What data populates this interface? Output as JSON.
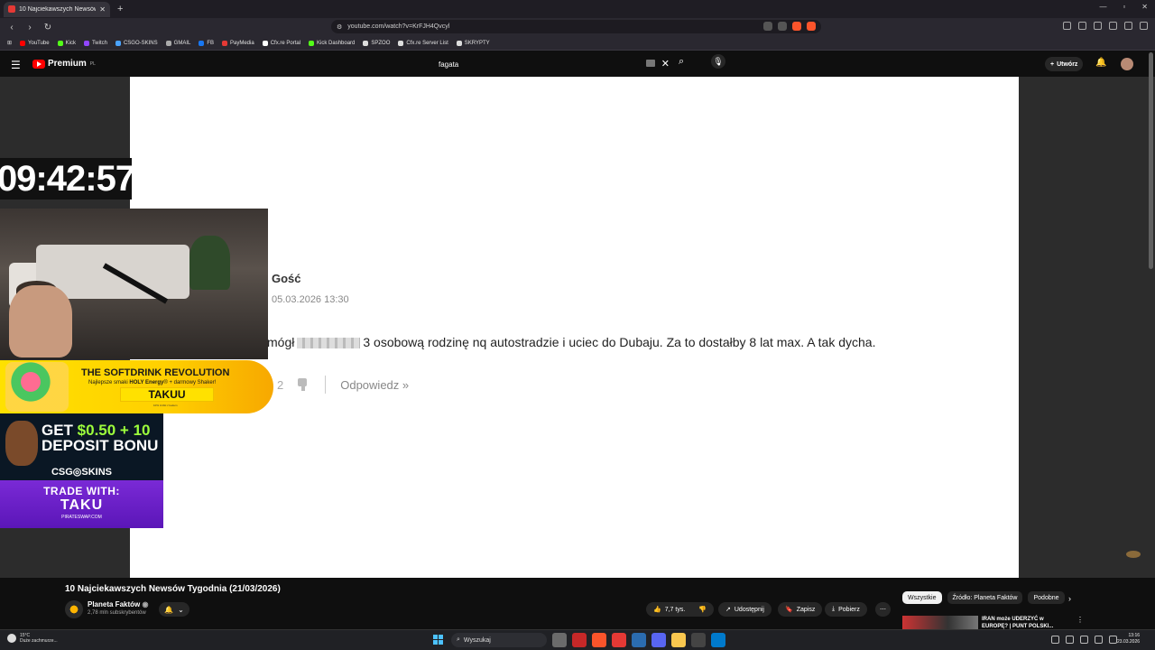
{
  "browser": {
    "tab_title": "10 Najciekawszych Newsów T...",
    "tab_close": "✕",
    "new_tab": "+",
    "url": "youtube.com/watch?v=KrFJH4Qvcyl",
    "bookmarks": [
      {
        "label": "YouTube",
        "color": "#ff0000"
      },
      {
        "label": "Kick",
        "color": "#53fc18"
      },
      {
        "label": "Twitch",
        "color": "#9146ff"
      },
      {
        "label": "CSGO-SKINS",
        "color": "#4aa3ff"
      },
      {
        "label": "GMAIL",
        "color": "#aaaaaa"
      },
      {
        "label": "FB",
        "color": "#1877f2"
      },
      {
        "label": "PayMedia",
        "color": "#e53935"
      },
      {
        "label": "Cfx.re Portal",
        "color": "#ffffff"
      },
      {
        "label": "Kick Dashboard",
        "color": "#53fc18"
      },
      {
        "label": "SPZOO",
        "color": "#dddddd"
      },
      {
        "label": "Cfx.re Server List",
        "color": "#dddddd"
      },
      {
        "label": "SKRYPTY",
        "color": "#dddddd"
      }
    ]
  },
  "youtube": {
    "brand": "Premium",
    "brand_region": "PL",
    "search_value": "fagata",
    "create_label": "Utwórz",
    "video_title": "10 Najciekawszych Newsów Tygodnia (21/03/2026)",
    "channel_name": "Planeta Faktów",
    "channel_subs": "2,78 mln subskrybentów",
    "like_count": "7,7 tys.",
    "share_label": "Udostępnij",
    "save_label": "Zapisz",
    "download_label": "Pobierz",
    "chips": [
      "Wszystkie",
      "Źródło: Planeta Faktów",
      "Podobne"
    ],
    "rec_title_1": "IRAN może UDERZYĆ w",
    "rec_title_2": "EUROPĘ? | PUNT POLSKI..."
  },
  "comment": {
    "author": "Gość",
    "date": "05.03.2026 13:30",
    "text_start": "mógł",
    "text_rest": "3 osobową rodzinę nq autostradzie i uciec do Dubaju. Za to dostałby 8 lat max. A tak dycha.",
    "vote_count": "2",
    "reply": "Odpowiedz »"
  },
  "overlay": {
    "clock": "09:42:57",
    "promo1_line1": "THE SOFTDRINK REVOLUTION",
    "promo1_line2a": "Najlepsze smaki ",
    "promo1_line2b": "HOLY Energy",
    "promo1_line2c": "® + darmowy Shaker!",
    "promo1_code": "TAKUU",
    "promo1_line3": "10% zniżki z kodem",
    "promo2_line1a": "GET ",
    "promo2_line1b": "$0.50 + 10",
    "promo2_line2": "DEPOSIT BONU",
    "promo2_brand": "CSG◎SKINS",
    "promo3_line1": "TRADE WITH:",
    "promo3_line2": "TAKU",
    "promo3_line3": "PIRATESWAP.COM"
  },
  "taskbar": {
    "weather_temp": "15°C",
    "weather_desc": "Duże zachmurze...",
    "search_label": "Wyszukaj",
    "time": "13:16",
    "date": "23.03.2026",
    "apps": [
      "#6b6b6b",
      "#c62828",
      "#fb542b",
      "#e53935",
      "#2b6cb0",
      "#5865f2",
      "#f9c74f",
      "#444444",
      "#007acc"
    ]
  }
}
